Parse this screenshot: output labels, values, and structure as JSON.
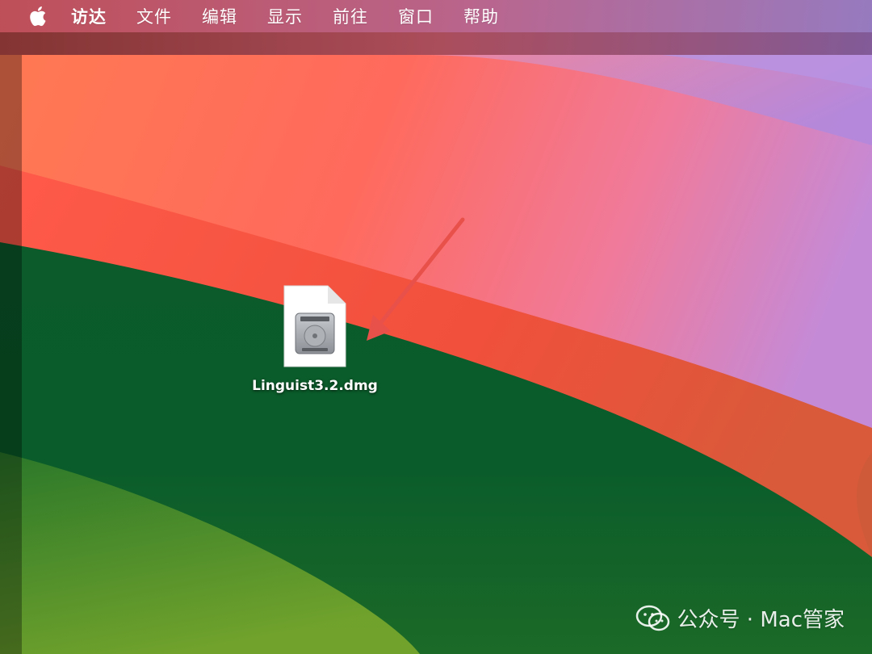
{
  "menubar": {
    "apple_icon": "apple-logo-icon",
    "items": [
      {
        "label": "访达",
        "app": true
      },
      {
        "label": "文件"
      },
      {
        "label": "编辑"
      },
      {
        "label": "显示"
      },
      {
        "label": "前往"
      },
      {
        "label": "窗口"
      },
      {
        "label": "帮助"
      }
    ]
  },
  "desktop": {
    "file": {
      "name": "Linguist3.2.dmg",
      "icon": "disk-image-file-icon"
    },
    "annotation": {
      "icon": "red-arrow-icon",
      "color": "#e8504a"
    }
  },
  "watermark": {
    "icon": "wechat-icon",
    "text": "公众号 · Mac管家"
  }
}
